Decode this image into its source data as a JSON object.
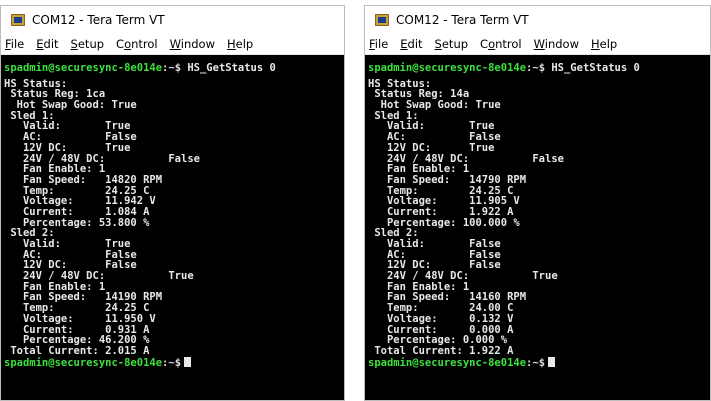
{
  "windows": [
    {
      "title": "COM12 - Tera Term VT",
      "menu": [
        {
          "label": "File",
          "acc": "F",
          "rest": "ile"
        },
        {
          "label": "Edit",
          "acc": "E",
          "rest": "dit"
        },
        {
          "label": "Setup",
          "acc": "S",
          "rest": "etup"
        },
        {
          "label": "Control",
          "pre": "C",
          "acc": "o",
          "rest": "ntrol"
        },
        {
          "label": "Window",
          "acc": "W",
          "rest": "indow"
        },
        {
          "label": "Help",
          "acc": "H",
          "rest": "elp"
        }
      ],
      "prompt_user": "spadmin@securesync-8e014e",
      "prompt_path": ":~$",
      "command": " HS_GetStatus 0",
      "lines": [
        "HS Status:",
        " Status Reg: 1ca",
        "  Hot Swap Good: True",
        " Sled 1:",
        "   Valid:       True",
        "   AC:          False",
        "   12V DC:      True",
        "   24V / 48V DC:          False",
        "   Fan Enable: 1",
        "   Fan Speed:   14820 RPM",
        "   Temp:        24.25 C",
        "   Voltage:     11.942 V",
        "   Current:     1.084 A",
        "   Percentage: 53.800 %",
        " Sled 2:",
        "   Valid:       True",
        "   AC:          False",
        "   12V DC:      False",
        "   24V / 48V DC:          True",
        "   Fan Enable: 1",
        "   Fan Speed:   14190 RPM",
        "   Temp:        24.25 C",
        "   Voltage:     11.950 V",
        "   Current:     0.931 A",
        "   Percentage: 46.200 %",
        " Total Current: 2.015 A"
      ]
    },
    {
      "title": "COM12 - Tera Term VT",
      "menu": [
        {
          "label": "File",
          "acc": "F",
          "rest": "ile"
        },
        {
          "label": "Edit",
          "acc": "E",
          "rest": "dit"
        },
        {
          "label": "Setup",
          "acc": "S",
          "rest": "etup"
        },
        {
          "label": "Control",
          "pre": "C",
          "acc": "o",
          "rest": "ntrol"
        },
        {
          "label": "Window",
          "acc": "W",
          "rest": "indow"
        },
        {
          "label": "Help",
          "acc": "H",
          "rest": "elp"
        }
      ],
      "prompt_user": "spadmin@securesync-8e014e",
      "prompt_path": ":~$",
      "command": " HS_GetStatus 0",
      "lines": [
        "HS Status:",
        " Status Reg: 14a",
        "  Hot Swap Good: True",
        " Sled 1:",
        "   Valid:       True",
        "   AC:          False",
        "   12V DC:      True",
        "   24V / 48V DC:          False",
        "   Fan Enable: 1",
        "   Fan Speed:   14790 RPM",
        "   Temp:        24.25 C",
        "   Voltage:     11.905 V",
        "   Current:     1.922 A",
        "   Percentage: 100.000 %",
        " Sled 2:",
        "   Valid:       False",
        "   AC:          False",
        "   12V DC:      False",
        "   24V / 48V DC:          True",
        "   Fan Enable: 1",
        "   Fan Speed:   14160 RPM",
        "   Temp:        24.00 C",
        "   Voltage:     0.132 V",
        "   Current:     0.000 A",
        "   Percentage: 0.000 %",
        " Total Current: 1.922 A"
      ]
    }
  ]
}
